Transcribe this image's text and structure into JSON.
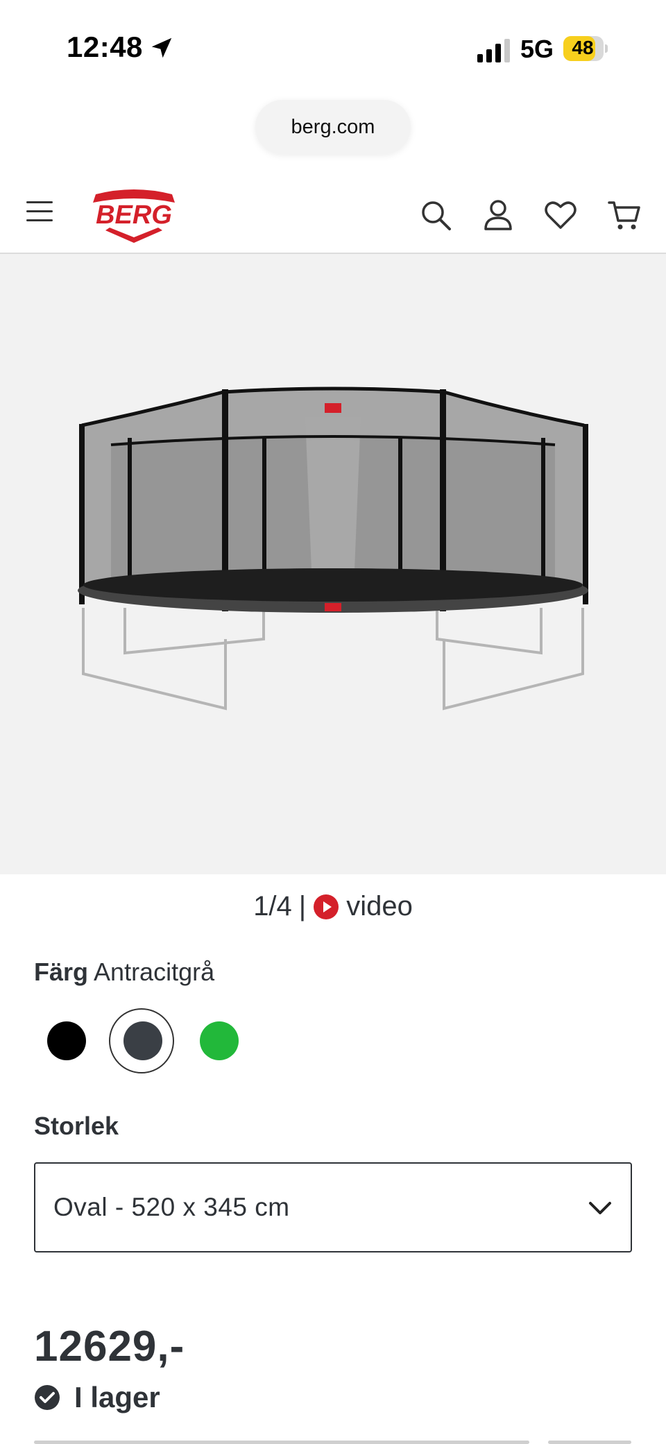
{
  "status_bar": {
    "time": "12:48",
    "network": "5G",
    "battery": "48"
  },
  "browser": {
    "url": "berg.com"
  },
  "header": {
    "logo_text": "BERG",
    "brand_color": "#d4202a",
    "icons": [
      "menu-icon",
      "search-icon",
      "account-icon",
      "heart-icon",
      "cart-icon"
    ]
  },
  "gallery": {
    "counter": "1/4",
    "separator": "|",
    "video_label": "video"
  },
  "color": {
    "label": "Färg",
    "selected": "Antracitgrå",
    "swatches": [
      {
        "name": "black",
        "hex": "#000000"
      },
      {
        "name": "anthracite",
        "hex": "#3a3f45",
        "selected": true
      },
      {
        "name": "green",
        "hex": "#22b83a"
      }
    ]
  },
  "size": {
    "label": "Storlek",
    "selected": "Oval - 520 x 345 cm"
  },
  "price": {
    "value": "12629,-"
  },
  "stock": {
    "status": "I lager"
  }
}
